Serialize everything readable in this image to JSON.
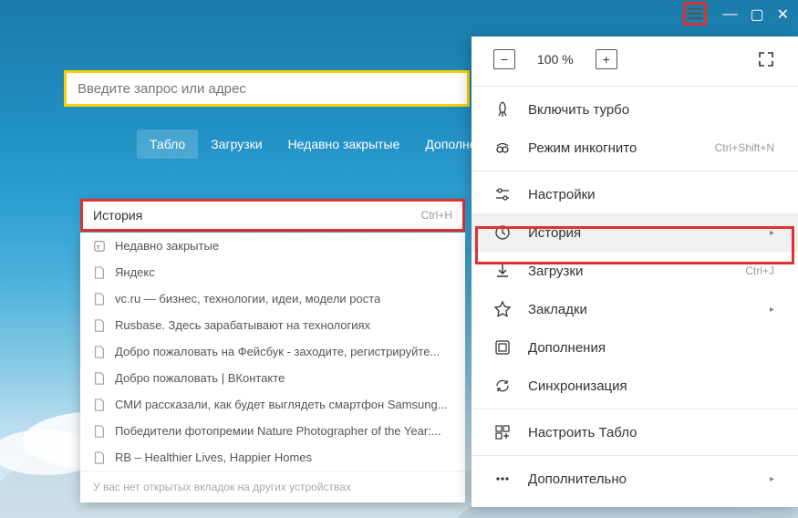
{
  "search": {
    "placeholder": "Введите запрос или адрес"
  },
  "tabs": {
    "tablo": "Табло",
    "downloads": "Загрузки",
    "recent": "Недавно закрытые",
    "addons": "Дополнения"
  },
  "history_panel": {
    "title": "История",
    "shortcut": "Ctrl+H",
    "footer": "У вас нет открытых вкладок на других устройствах"
  },
  "history_items": [
    "Недавно закрытые",
    "Яндекс",
    "vc.ru — бизнес, технологии, идеи, модели роста",
    "Rusbase. Здесь зарабатывают на технологиях",
    "Добро пожаловать на Фейсбук - заходите, регистрируйте...",
    "Добро пожаловать | ВКонтакте",
    "СМИ рассказали, как будет выглядеть смартфон Samsung...",
    "Победители фотопремии Nature Photographer of the Year:...",
    "RB – Healthier Lives, Happier Homes"
  ],
  "zoom": {
    "level": "100 %"
  },
  "menu": {
    "turbo": "Включить турбо",
    "incognito": "Режим инкогнито",
    "incognito_sc": "Ctrl+Shift+N",
    "settings": "Настройки",
    "history": "История",
    "downloads": "Загрузки",
    "downloads_sc": "Ctrl+J",
    "bookmarks": "Закладки",
    "addons": "Дополнения",
    "sync": "Синхронизация",
    "customize": "Настроить Табло",
    "more": "Дополнительно"
  }
}
